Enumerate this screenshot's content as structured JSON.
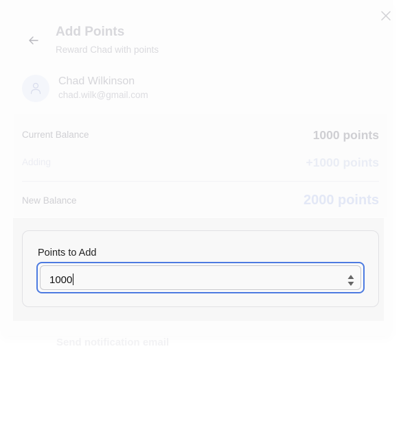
{
  "header": {
    "title": "Add Points",
    "subtitle": "Reward Chad with points",
    "back_icon": "arrow-left-icon",
    "close_icon": "close-icon"
  },
  "user": {
    "name": "Chad Wilkinson",
    "email": "chad.wilk@gmail.com",
    "avatar_icon": "user-icon"
  },
  "summary": {
    "current_balance": {
      "label": "Current Balance",
      "value": "1000 points"
    },
    "adding": {
      "label": "Adding",
      "value": "+1000 points"
    },
    "new_balance": {
      "label": "New Balance",
      "value": "2000 points"
    }
  },
  "points_input": {
    "label": "Points to Add",
    "value": "1000",
    "spinner_icon": "number-spinner-icon"
  },
  "notification": {
    "label": "Send notification email"
  },
  "colors": {
    "focus_ring": "#4c7ae0",
    "accent_faded": "#e3e8f6",
    "muted_text": "#d8d8dc"
  }
}
